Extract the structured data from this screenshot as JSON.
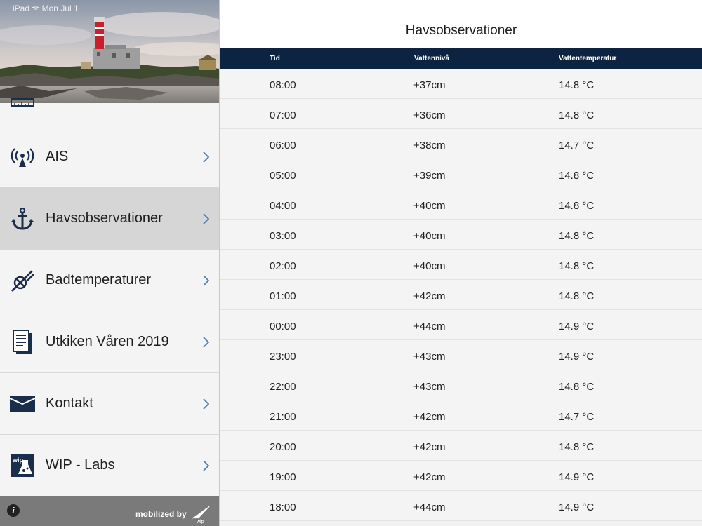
{
  "status_bar": {
    "text": "iPad ᯤ  Mon Jul 1"
  },
  "sidebar": {
    "items": [
      {
        "label": "",
        "icon": "ruler-icon"
      },
      {
        "label": "AIS",
        "icon": "antenna-icon"
      },
      {
        "label": "Havsobservationer",
        "icon": "anchor-icon",
        "active": true
      },
      {
        "label": "Badtemperaturer",
        "icon": "no-swimming-icon"
      },
      {
        "label": "Utkiken Våren 2019",
        "icon": "document-icon"
      },
      {
        "label": "Kontakt",
        "icon": "envelope-icon"
      },
      {
        "label": "WIP - Labs",
        "icon": "labs-flask-icon"
      }
    ],
    "footer": {
      "mobilized_label": "mobilized by",
      "logo_text": "wip"
    }
  },
  "main": {
    "title": "Havsobservationer",
    "columns": [
      "Tid",
      "Vattennivå",
      "Vattentemperatur"
    ],
    "rows": [
      [
        "08:00",
        "+37cm",
        "14.8 °C"
      ],
      [
        "07:00",
        "+36cm",
        "14.8 °C"
      ],
      [
        "06:00",
        "+38cm",
        "14.7 °C"
      ],
      [
        "05:00",
        "+39cm",
        "14.8 °C"
      ],
      [
        "04:00",
        "+40cm",
        "14.8 °C"
      ],
      [
        "03:00",
        "+40cm",
        "14.8 °C"
      ],
      [
        "02:00",
        "+40cm",
        "14.8 °C"
      ],
      [
        "01:00",
        "+42cm",
        "14.8 °C"
      ],
      [
        "00:00",
        "+44cm",
        "14.9 °C"
      ],
      [
        "23:00",
        "+43cm",
        "14.9 °C"
      ],
      [
        "22:00",
        "+43cm",
        "14.8 °C"
      ],
      [
        "21:00",
        "+42cm",
        "14.7 °C"
      ],
      [
        "20:00",
        "+42cm",
        "14.8 °C"
      ],
      [
        "19:00",
        "+42cm",
        "14.9 °C"
      ],
      [
        "18:00",
        "+44cm",
        "14.9 °C"
      ]
    ]
  },
  "colors": {
    "header_bg": "#0c2341",
    "icon_navy": "#1a2e4c",
    "chevron_blue": "#4a7fb5",
    "active_row": "#d6d6d6"
  }
}
